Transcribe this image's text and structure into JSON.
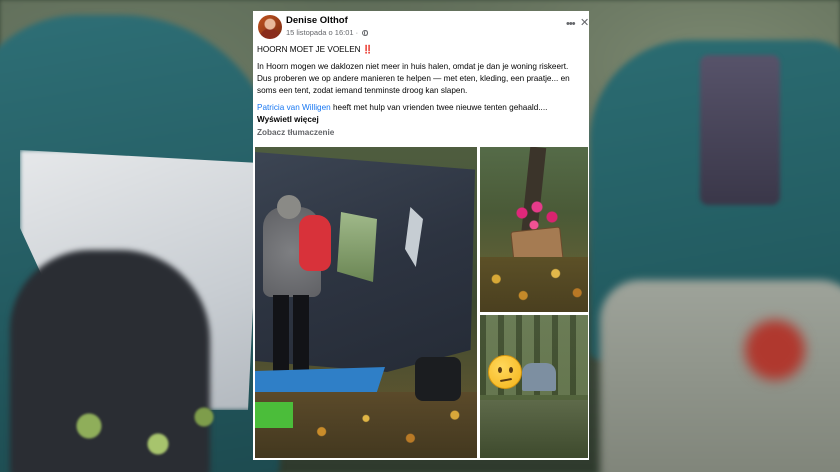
{
  "post": {
    "author": "Denise Olthof",
    "timestamp": "15 listopada o 16:01",
    "headline": "HOORN MOET JE VOELEN",
    "headline_emoji": "‼️",
    "body": "In Hoorn mogen we daklozen niet meer in huis halen, omdat je dan je woning riskeert. Dus proberen we op andere manieren te helpen — met eten, kleding, een praatje... en soms een tent, zodat iemand tenminste droog kan slapen.",
    "mention": "Patricia van Willigen",
    "mention_suffix": " heeft met hulp van vrienden  twee nieuwe tenten gehaald....",
    "see_more": "Wyświetl więcej",
    "translate": "Zobacz tłumaczenie"
  },
  "icons": {
    "more": "more-options-icon",
    "close": "close-icon",
    "audience": "globe-icon"
  },
  "colors": {
    "mention": "#1877f2",
    "meta": "#65676b",
    "text": "#050505"
  }
}
